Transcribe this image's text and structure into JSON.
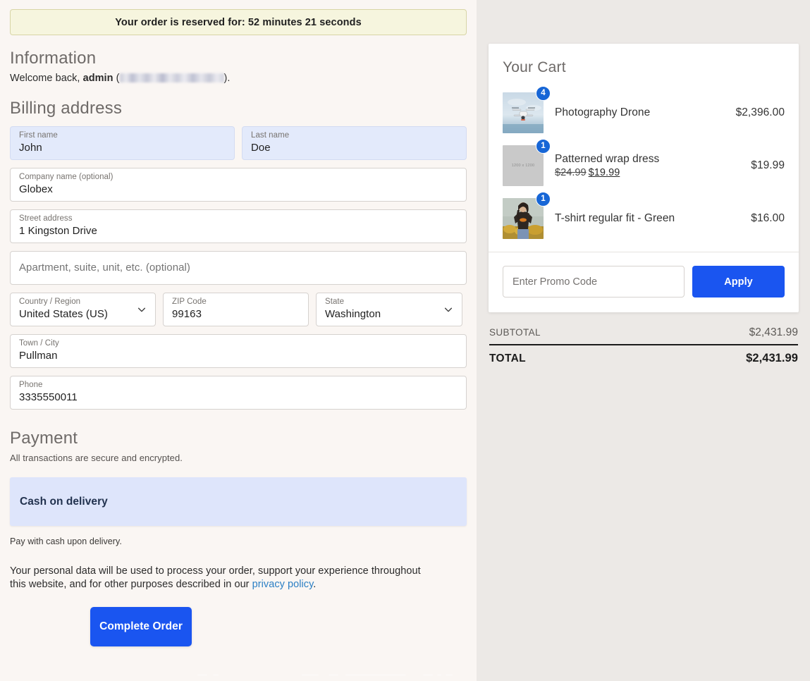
{
  "banner": {
    "text": "Your order is reserved for: 52 minutes 21 seconds"
  },
  "information": {
    "title": "Information",
    "welcome_prefix": "Welcome back, ",
    "username": "admin",
    "welcome_open_paren": " (",
    "welcome_close_paren": ").",
    "email_redacted": true
  },
  "billing": {
    "title": "Billing address",
    "fields": [
      {
        "label": "First name",
        "value": "John",
        "type": "text",
        "autofill": true
      },
      {
        "label": "Last name",
        "value": "Doe",
        "type": "text",
        "autofill": true
      },
      {
        "label": "Company name (optional)",
        "value": "Globex",
        "type": "text",
        "autofill": false
      },
      {
        "label": "Street address",
        "value": "1 Kingston Drive",
        "type": "text",
        "autofill": false
      },
      {
        "label": "",
        "value": "",
        "placeholder": "Apartment, suite, unit, etc. (optional)",
        "type": "placeholder",
        "autofill": false
      },
      {
        "label": "Country / Region",
        "value": "United States (US)",
        "type": "select",
        "autofill": false
      },
      {
        "label": "ZIP Code",
        "value": "99163",
        "type": "text",
        "autofill": false
      },
      {
        "label": "State",
        "value": "Washington",
        "type": "select",
        "autofill": false
      },
      {
        "label": "Town / City",
        "value": "Pullman",
        "type": "text",
        "autofill": false
      },
      {
        "label": "Phone",
        "value": "3335550011",
        "type": "text",
        "autofill": false
      }
    ]
  },
  "payment": {
    "title": "Payment",
    "subtitle": "All transactions are secure and encrypted.",
    "selected_method": "Cash on delivery",
    "method_note": "Pay with cash upon delivery.",
    "privacy_text_part1": "Your personal data will be used to process your order, support your experience throughout this website, and for other purposes described in our ",
    "privacy_link_label": "privacy policy",
    "privacy_text_part2": ".",
    "complete_button": "Complete Order"
  },
  "cart": {
    "title": "Your Cart",
    "items": [
      {
        "name": "Photography Drone",
        "qty": "4",
        "price_display": "$2,396.00",
        "image_type": "drone-photo",
        "has_sale": false
      },
      {
        "name": "Patterned wrap dress",
        "qty": "1",
        "price_display": "$19.99",
        "image_type": "placeholder",
        "image_placeholder_text": "1200 x 1200",
        "has_sale": true,
        "price_old": "$24.99",
        "price_new": "$19.99"
      },
      {
        "name": "T-shirt regular fit - Green",
        "qty": "1",
        "price_display": "$16.00",
        "image_type": "tshirt-photo",
        "has_sale": false
      }
    ],
    "promo": {
      "placeholder": "Enter Promo Code",
      "value": "",
      "apply_label": "Apply"
    },
    "totals": {
      "subtotal_label": "SUBTOTAL",
      "subtotal_value": "$2,431.99",
      "total_label": "TOTAL",
      "total_value": "$2,431.99"
    }
  },
  "colors": {
    "accent_blue": "#1a55f0",
    "badge_blue": "#1766d6",
    "banner_yellow": "#f6f5de",
    "payment_panel_blue": "#dee5fb",
    "link_blue": "#2b7fc4",
    "left_bg": "#faf6f3",
    "right_bg": "#ece9e6"
  }
}
